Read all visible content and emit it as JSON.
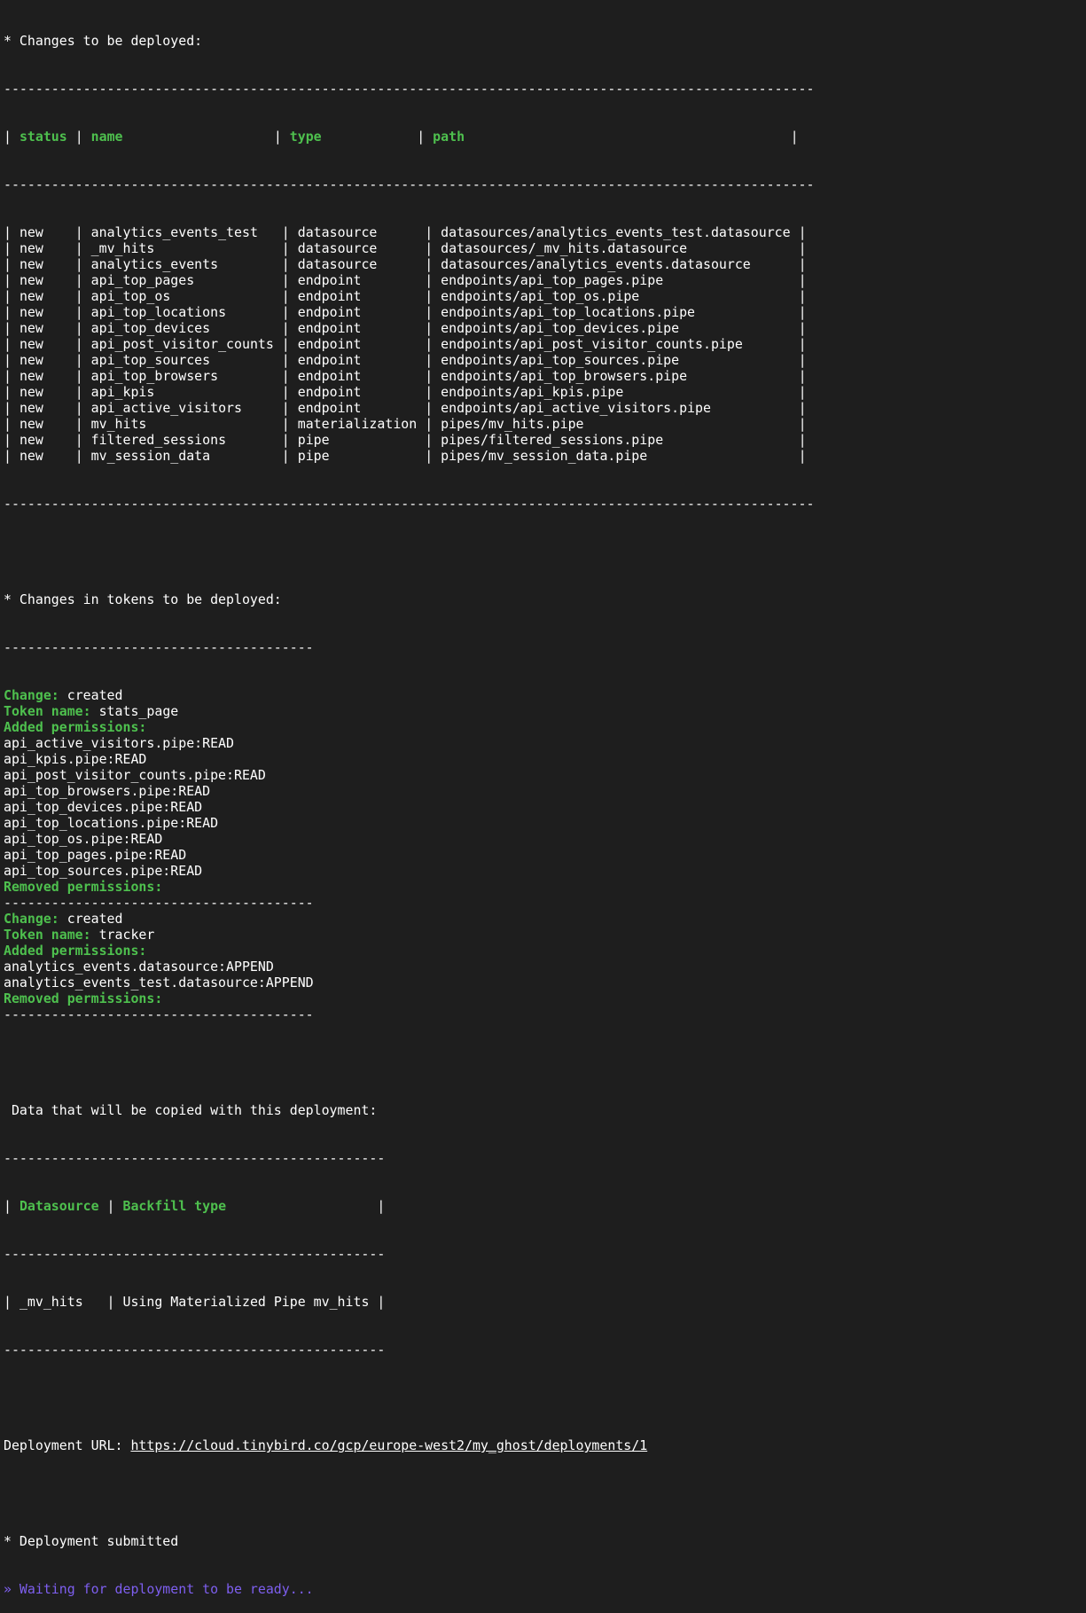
{
  "changes_header": "* Changes to be deployed:",
  "changes_table": {
    "columns": [
      "status",
      "name",
      "type",
      "path"
    ],
    "rows": [
      {
        "status": "new",
        "name": "analytics_events_test",
        "type": "datasource",
        "path": "datasources/analytics_events_test.datasource"
      },
      {
        "status": "new",
        "name": "_mv_hits",
        "type": "datasource",
        "path": "datasources/_mv_hits.datasource"
      },
      {
        "status": "new",
        "name": "analytics_events",
        "type": "datasource",
        "path": "datasources/analytics_events.datasource"
      },
      {
        "status": "new",
        "name": "api_top_pages",
        "type": "endpoint",
        "path": "endpoints/api_top_pages.pipe"
      },
      {
        "status": "new",
        "name": "api_top_os",
        "type": "endpoint",
        "path": "endpoints/api_top_os.pipe"
      },
      {
        "status": "new",
        "name": "api_top_locations",
        "type": "endpoint",
        "path": "endpoints/api_top_locations.pipe"
      },
      {
        "status": "new",
        "name": "api_top_devices",
        "type": "endpoint",
        "path": "endpoints/api_top_devices.pipe"
      },
      {
        "status": "new",
        "name": "api_post_visitor_counts",
        "type": "endpoint",
        "path": "endpoints/api_post_visitor_counts.pipe"
      },
      {
        "status": "new",
        "name": "api_top_sources",
        "type": "endpoint",
        "path": "endpoints/api_top_sources.pipe"
      },
      {
        "status": "new",
        "name": "api_top_browsers",
        "type": "endpoint",
        "path": "endpoints/api_top_browsers.pipe"
      },
      {
        "status": "new",
        "name": "api_kpis",
        "type": "endpoint",
        "path": "endpoints/api_kpis.pipe"
      },
      {
        "status": "new",
        "name": "api_active_visitors",
        "type": "endpoint",
        "path": "endpoints/api_active_visitors.pipe"
      },
      {
        "status": "new",
        "name": "mv_hits",
        "type": "materialization",
        "path": "pipes/mv_hits.pipe"
      },
      {
        "status": "new",
        "name": "filtered_sessions",
        "type": "pipe",
        "path": "pipes/filtered_sessions.pipe"
      },
      {
        "status": "new",
        "name": "mv_session_data",
        "type": "pipe",
        "path": "pipes/mv_session_data.pipe"
      }
    ]
  },
  "tokens_header": "* Changes in tokens to be deployed:",
  "token_labels": {
    "change": "Change:",
    "token_name": "Token name:",
    "added": "Added permissions:",
    "removed": "Removed permissions:"
  },
  "tokens": [
    {
      "change": "created",
      "name": "stats_page",
      "added": [
        "api_active_visitors.pipe:READ",
        "api_kpis.pipe:READ",
        "api_post_visitor_counts.pipe:READ",
        "api_top_browsers.pipe:READ",
        "api_top_devices.pipe:READ",
        "api_top_locations.pipe:READ",
        "api_top_os.pipe:READ",
        "api_top_pages.pipe:READ",
        "api_top_sources.pipe:READ"
      ],
      "removed": []
    },
    {
      "change": "created",
      "name": "tracker",
      "added": [
        "analytics_events.datasource:APPEND",
        "analytics_events_test.datasource:APPEND"
      ],
      "removed": []
    }
  ],
  "copy_header": " Data that will be copied with this deployment:",
  "copy_table": {
    "columns": [
      "Datasource",
      "Backfill type"
    ],
    "rows": [
      {
        "datasource": "_mv_hits",
        "backfill": "Using Materialized Pipe mv_hits"
      }
    ]
  },
  "deployment_url_label": "Deployment URL:",
  "deployment_url": "https://cloud.tinybird.co/gcp/europe-west2/my_ghost/deployments/1",
  "submitted": "* Deployment submitted",
  "waiting": "» Waiting for deployment to be ready...",
  "colors": {
    "background": "#1e1e1e",
    "text": "#ffffff",
    "green": "#4ec04e",
    "purple": "#7e5ff0"
  },
  "icons": {
    "waiting_prompt": "chevron-right-double-icon"
  }
}
